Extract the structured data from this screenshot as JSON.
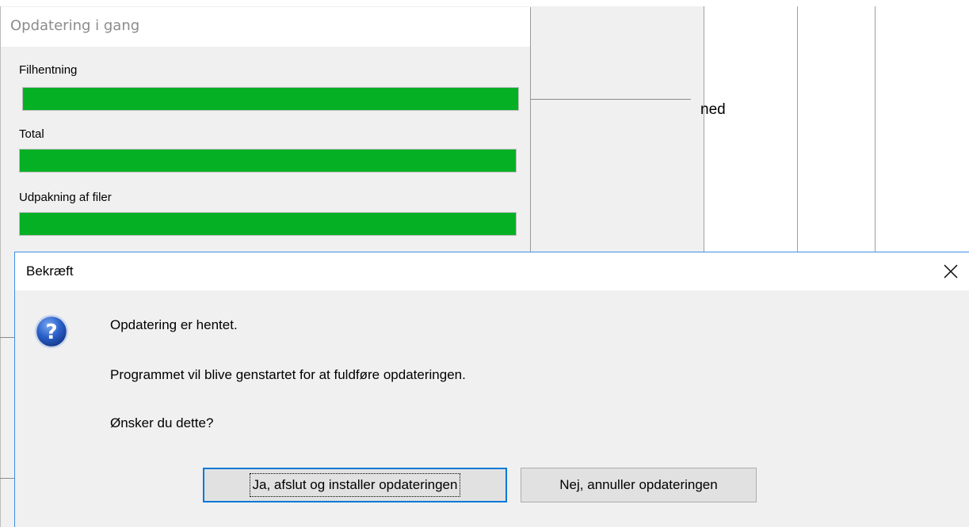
{
  "background_window": {
    "partial_text": "ned"
  },
  "progress_window": {
    "title": "Opdatering i gang",
    "items": [
      {
        "label": "Filhentning",
        "progress_percent": 100
      },
      {
        "label": "Total",
        "progress_percent": 100
      },
      {
        "label": "Udpakning af filer",
        "progress_percent": 100
      }
    ],
    "bar_color": "#06b025"
  },
  "dialog": {
    "title": "Bekræft",
    "close_icon": "close-icon",
    "icon": "question-icon",
    "messages": [
      "Opdatering er hentet.",
      "Programmet vil blive genstartet for at fuldføre opdateringen.",
      "Ønsker du dette?"
    ],
    "buttons": {
      "confirm_label": "Ja, afslut og installer opdateringen",
      "cancel_label": "Nej, annuller opdateringen"
    },
    "accent_color": "#0078d7"
  }
}
